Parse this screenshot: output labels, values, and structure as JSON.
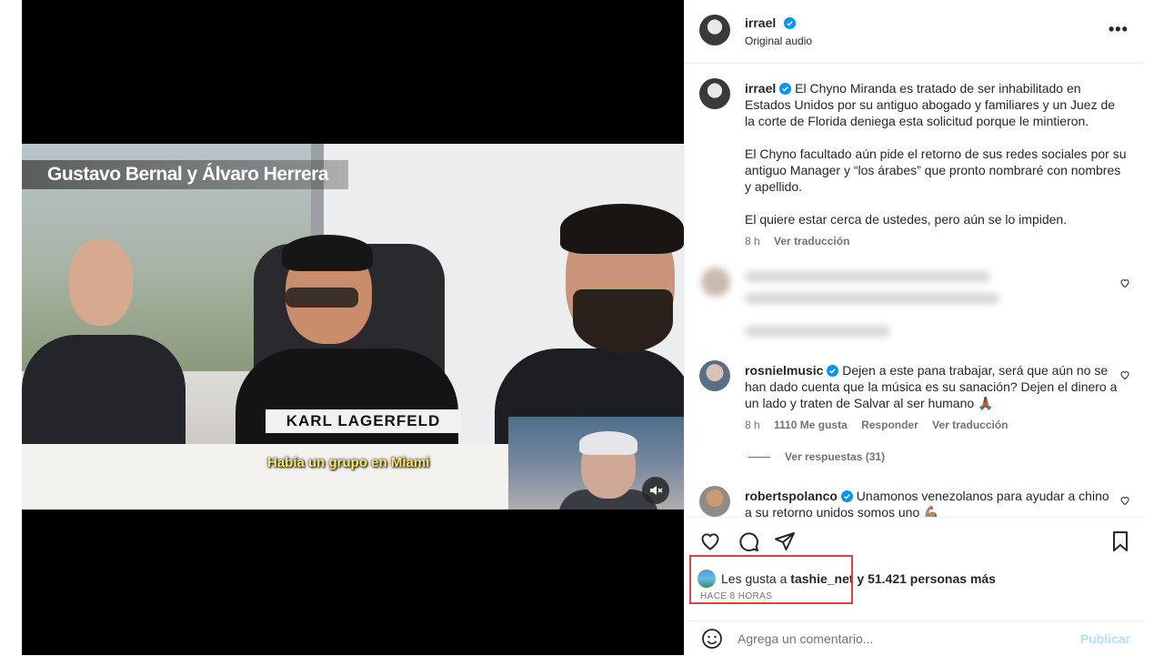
{
  "post": {
    "username": "irrael",
    "audio": "Original audio",
    "more_label": "•••"
  },
  "video": {
    "banner": "Gustavo Bernal y Álvaro Herrera",
    "subtitle": "Había un grupo en Miami",
    "shirt_logo": "KARL LAGERFELD"
  },
  "caption": {
    "username": "irrael",
    "p1": "El Chyno Miranda es tratado de ser inhabilitado en Estados Unidos por su antiguo abogado y familiares y un Juez de la corte de Florida deniega esta solicitud porque le mintieron.",
    "p2": "El Chyno facultado aún pide el retorno de sus redes sociales por su antiguo Manager y “los árabes” que pronto nombraré con nombres y apellido.",
    "p3": "El quiere estar cerca de ustedes, pero aún se lo impiden.",
    "time": "8 h",
    "translate": "Ver traducción"
  },
  "comments": [
    {
      "username": "rosnielmusic",
      "text": "Dejen a este pana trabajar, será que aún no se han dado cuenta que la música es su sanación? Dejen el dinero a un lado y traten de Salvar al ser humano 🙏🏾",
      "time": "8 h",
      "likes": "1110 Me gusta",
      "reply": "Responder",
      "translate": "Ver traducción",
      "view_replies": "Ver respuestas (31)"
    },
    {
      "username": "robertspolanco",
      "text": "Unamonos venezolanos para ayudar a chino a su retorno unidos somos uno 💪🏽"
    }
  ],
  "likes": {
    "prefix": "Les gusta a",
    "user": "tashie_net",
    "suffix": "y 51.421 personas más",
    "time": "HACE 8 HORAS"
  },
  "add_comment": {
    "placeholder": "Agrega un comentario...",
    "publish": "Publicar"
  },
  "colors": {
    "verified": "#0095f6",
    "highlight": "#e0413e",
    "publish": "#b2dffc"
  }
}
